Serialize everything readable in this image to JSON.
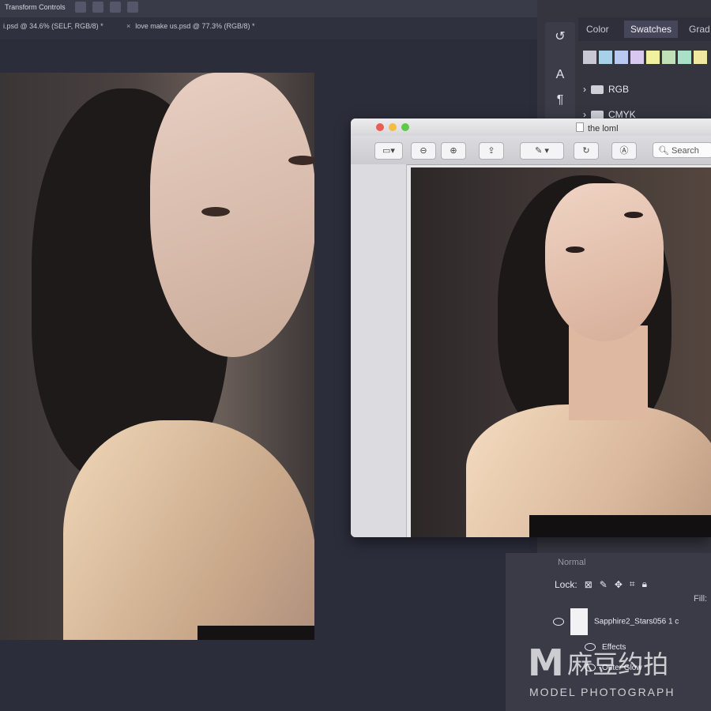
{
  "app": {
    "transform_label": "Transform Controls"
  },
  "tabs": [
    {
      "label": "i.psd @ 34.6% (SELF, RGB/8) *"
    },
    {
      "label": "love make us.psd @ 77.3% (RGB/8) *"
    }
  ],
  "right_panel": {
    "tabs": [
      "Color",
      "Swatches",
      "Grad"
    ],
    "swatch_colors": [
      "#c8c8d4",
      "#a8d0e8",
      "#b8c8f0",
      "#d8c8f0",
      "#f0f0a0",
      "#c0e0b8",
      "#a8e0c8",
      "#f0e8a0"
    ],
    "folders": [
      "RGB",
      "CMYK"
    ]
  },
  "preview_window": {
    "title": "the loml",
    "search_label": "Search"
  },
  "layers_panel": {
    "mode": "Normal",
    "lock_label": "Lock:",
    "fill_label": "Fill:",
    "layer_name": "Sapphire2_Stars056 1 c",
    "effects_label": "Effects",
    "outer_glow_label": "Outer Glow"
  },
  "watermark": {
    "letter": "M",
    "chinese": "麻豆约拍",
    "english": "MODEL PHOTOGRAPH"
  }
}
